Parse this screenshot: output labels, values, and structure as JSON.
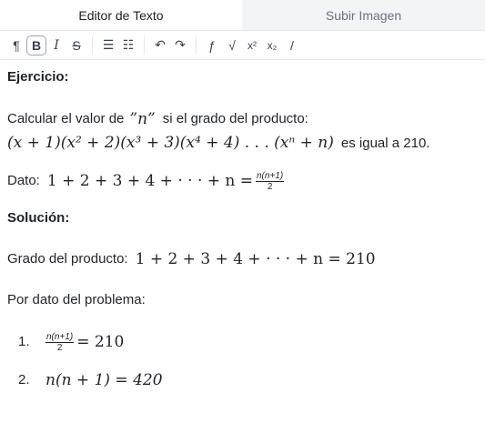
{
  "tabs": [
    {
      "label": "Editor de Texto",
      "active": true
    },
    {
      "label": "Subir Imagen",
      "active": false
    }
  ],
  "toolbar": {
    "icons": [
      "paragraph-icon",
      "bold-icon",
      "italic-icon",
      "strikethrough-icon",
      "bullet-list-icon",
      "ordered-list-icon",
      "undo-icon",
      "redo-icon",
      "function-icon",
      "sqrt-icon",
      "superscript-icon",
      "subscript-icon",
      "slash-icon"
    ],
    "glyphs": {
      "paragraph": "¶",
      "bold": "B",
      "italic": "I",
      "strike": "S",
      "bullet": "☰",
      "ordered": "☷",
      "undo": "↶",
      "redo": "↷",
      "func": "ƒ",
      "sqrt": "√",
      "sup": "x²",
      "sub": "x₂",
      "slash": "/"
    }
  },
  "content": {
    "ejercicio_heading": "Ejercicio:",
    "statement_text": "Calcular el valor de",
    "statement_var": "”n”",
    "statement_text2": "si el grado del producto:",
    "product_expr": "(x + 1)(x² + 2)(x³ + 3)(x⁴ + 4) . . . (xⁿ + n)",
    "product_tail": "es igual a 210.",
    "dato_label": "Dato:",
    "dato_expr": "1 + 2 + 3 + 4 + · · · + n =",
    "dato_frac_num": "n(n+1)",
    "dato_frac_den": "2",
    "solucion_heading": "Solución:",
    "grado_label": "Grado del producto:",
    "grado_expr": "1 + 2 + 3 + 4 + · · · + n = 210",
    "por_dato": "Por dato del problema:",
    "items": [
      {
        "num": "1.",
        "frac_num": "n(n+1)",
        "frac_den": "2",
        "rest": "= 210"
      },
      {
        "num": "2.",
        "expr": "n(n + 1) = 420"
      }
    ]
  }
}
